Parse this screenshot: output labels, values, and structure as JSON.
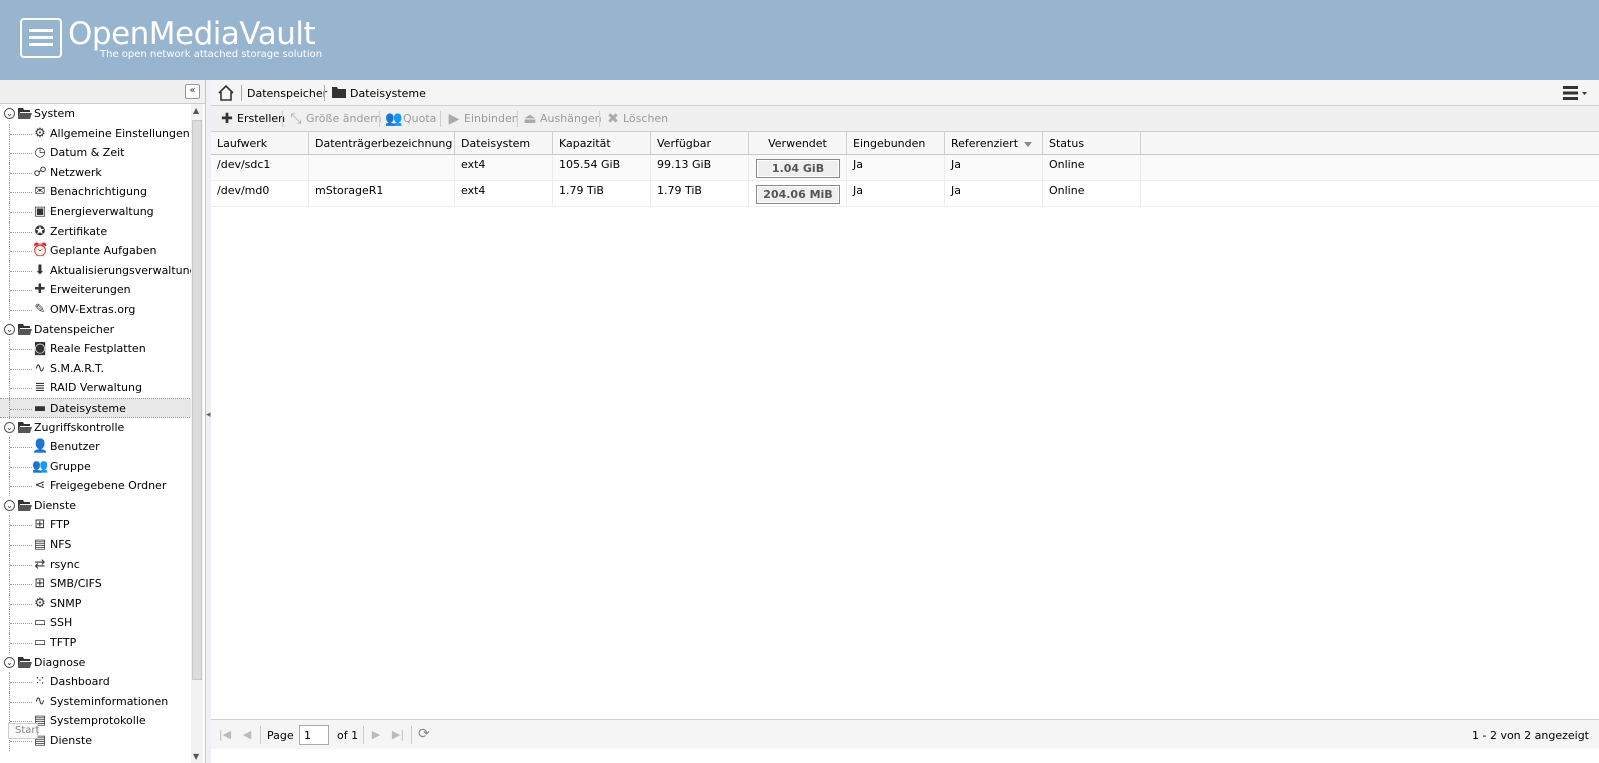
{
  "header": {
    "title": "OpenMediaVault",
    "subtitle": "The open network attached storage solution"
  },
  "sidebar": {
    "collapse_icon": "double-chevron-left-icon",
    "tree": [
      {
        "type": "cat",
        "label": "System",
        "name": "system"
      },
      {
        "type": "leaf",
        "label": "Allgemeine Einstellungen",
        "icon": "⚙",
        "name": "general-settings"
      },
      {
        "type": "leaf",
        "label": "Datum & Zeit",
        "icon": "◷",
        "name": "date-time"
      },
      {
        "type": "leaf",
        "label": "Netzwerk",
        "icon": "☍",
        "name": "network"
      },
      {
        "type": "leaf",
        "label": "Benachrichtigung",
        "icon": "✉",
        "name": "notification"
      },
      {
        "type": "leaf",
        "label": "Energieverwaltung",
        "icon": "▣",
        "name": "power-management"
      },
      {
        "type": "leaf",
        "label": "Zertifikate",
        "icon": "✪",
        "name": "certificates"
      },
      {
        "type": "leaf",
        "label": "Geplante Aufgaben",
        "icon": "⏰",
        "name": "scheduled-jobs"
      },
      {
        "type": "leaf",
        "label": "Aktualisierungsverwaltung",
        "icon": "⬇",
        "name": "update-management"
      },
      {
        "type": "leaf",
        "label": "Erweiterungen",
        "icon": "✚",
        "name": "plugins"
      },
      {
        "type": "leaf",
        "label": "OMV-Extras.org",
        "icon": "✎",
        "name": "omv-extras"
      },
      {
        "type": "cat",
        "label": "Datenspeicher",
        "name": "storage"
      },
      {
        "type": "leaf",
        "label": "Reale Festplatten",
        "icon": "◙",
        "name": "physical-disks"
      },
      {
        "type": "leaf",
        "label": "S.M.A.R.T.",
        "icon": "∿",
        "name": "smart"
      },
      {
        "type": "leaf",
        "label": "RAID Verwaltung",
        "icon": "≣",
        "name": "raid-management"
      },
      {
        "type": "leaf",
        "label": "Dateisysteme",
        "icon": "▬",
        "name": "filesystems",
        "selected": true
      },
      {
        "type": "cat",
        "label": "Zugriffskontrolle",
        "name": "access-control"
      },
      {
        "type": "leaf",
        "label": "Benutzer",
        "icon": "👤",
        "name": "user"
      },
      {
        "type": "leaf",
        "label": "Gruppe",
        "icon": "👥",
        "name": "group"
      },
      {
        "type": "leaf",
        "label": "Freigegebene Ordner",
        "icon": "⋖",
        "name": "shared-folders"
      },
      {
        "type": "cat",
        "label": "Dienste",
        "name": "services"
      },
      {
        "type": "leaf",
        "label": "FTP",
        "icon": "⊞",
        "name": "ftp"
      },
      {
        "type": "leaf",
        "label": "NFS",
        "icon": "▤",
        "name": "nfs"
      },
      {
        "type": "leaf",
        "label": "rsync",
        "icon": "⇄",
        "name": "rsync"
      },
      {
        "type": "leaf",
        "label": "SMB/CIFS",
        "icon": "⊞",
        "name": "smb-cifs"
      },
      {
        "type": "leaf",
        "label": "SNMP",
        "icon": "⚙",
        "name": "snmp"
      },
      {
        "type": "leaf",
        "label": "SSH",
        "icon": "▭",
        "name": "ssh"
      },
      {
        "type": "leaf",
        "label": "TFTP",
        "icon": "▭",
        "name": "tftp"
      },
      {
        "type": "cat",
        "label": "Diagnose",
        "name": "diagnostics"
      },
      {
        "type": "leaf",
        "label": "Dashboard",
        "icon": "⁙",
        "name": "dashboard"
      },
      {
        "type": "leaf",
        "label": "Systeminformationen",
        "icon": "∿",
        "name": "system-information"
      },
      {
        "type": "leaf",
        "label": "Systemprotokolle",
        "icon": "▤",
        "name": "system-logs"
      },
      {
        "type": "leaf",
        "label": "Dienste",
        "icon": "▤",
        "name": "diagnostics-services"
      }
    ],
    "start_label": "Start"
  },
  "breadcrumb": {
    "home_icon": "home-icon",
    "item1": "Datenspeicher",
    "item2": "Dateisysteme"
  },
  "toolbar": {
    "create": "Erstellen",
    "resize": "Größe ändern",
    "quota": "Quota",
    "mount": "Einbinden",
    "unmount": "Aushängen",
    "delete": "Löschen"
  },
  "grid": {
    "columns": [
      "Laufwerk",
      "Datenträgerbezeichnung",
      "Dateisystem",
      "Kapazität",
      "Verfügbar",
      "Verwendet",
      "Eingebunden",
      "Referenziert",
      "Status"
    ],
    "sort_column": "Referenziert",
    "rows": [
      {
        "device": "/dev/sdc1",
        "label": "",
        "fs": "ext4",
        "capacity": "105.54 GiB",
        "available": "99.13 GiB",
        "used": "1.04 GiB",
        "mounted": "Ja",
        "referenced": "Ja",
        "status": "Online"
      },
      {
        "device": "/dev/md0",
        "label": "mStorageR1",
        "fs": "ext4",
        "capacity": "1.79 TiB",
        "available": "1.79 TiB",
        "used": "204.06 MiB",
        "mounted": "Ja",
        "referenced": "Ja",
        "status": "Online"
      }
    ]
  },
  "pager": {
    "page_label": "Page",
    "page_value": "1",
    "of_label": "of 1",
    "info": "1 - 2 von 2 angezeigt"
  }
}
